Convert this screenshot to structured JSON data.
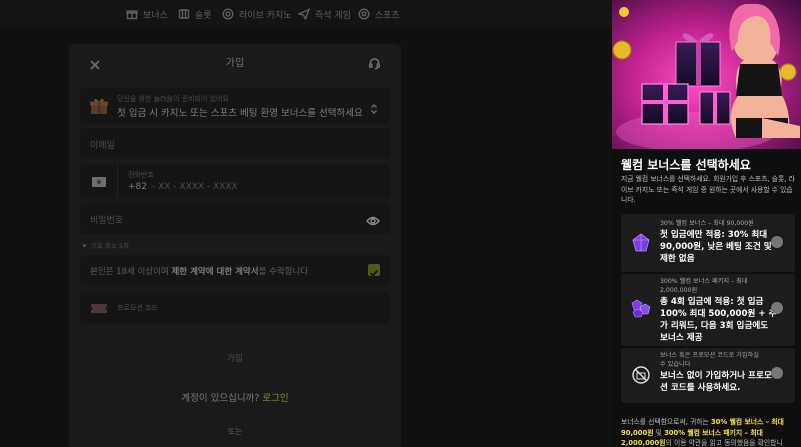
{
  "nav": {
    "items": [
      {
        "label": "보너스",
        "icon": "gift-icon"
      },
      {
        "label": "슬롯",
        "icon": "slot-machine-icon"
      },
      {
        "label": "라이브 카지노",
        "icon": "casino-chip-icon"
      },
      {
        "label": "즉석 게임",
        "icon": "paper-plane-icon"
      },
      {
        "label": "스포츠",
        "icon": "soccer-ball-icon"
      }
    ]
  },
  "signup": {
    "title": "가입",
    "bonus_hint": "당신을 위한 놀라움이 준비되어 있어요",
    "bonus_value": "첫 입금 시 카지노 또는 스포츠 베팅 환영 보너스를 선택하세요",
    "email_placeholder": "이메일",
    "phone_label": "전화번호",
    "phone_code": "+82",
    "phone_mask": "- XX - XXXX - XXXX",
    "password_placeholder": "비밀번호",
    "password_rule": "기호 최소 5자",
    "terms_prefix": "본인은 18세 이상이며 ",
    "terms_link": "제한 계약에 대한 계약서",
    "terms_suffix": "를 수락합니다",
    "promo_placeholder": "프로모션 코드",
    "submit_label": "가입",
    "login_question": "계정이 있으십니까?",
    "login_link": "로그인",
    "or_label": "또는"
  },
  "bonus_panel": {
    "title": "웰컴 보너스를 선택하세요",
    "description": "지금 웰컴 보너스를 선택하세요. 회원가입 후 스포츠, 슬롯, 라이브 카지노 또는 즉석 게임 중 원하는 곳에서 사용할 수 있습니다.",
    "options": [
      {
        "tag": "30% 웰컴 보너스 – 최대 90,000원",
        "text": "첫 입금에만 적용: 30% 최대 90,000원, 낮은 베팅 조건 및 제한 없음",
        "icon": "purple-gem-icon",
        "selected": false
      },
      {
        "tag": "300% 웰컴 보너스 패키지 – 최대 2,000,000원",
        "text": "총 4회 입금에 적용: 첫 입금 100% 최대 500,000원 + 추가 리워드, 다음 3회 입금에도 보너스 제공",
        "icon": "purple-gems-icon",
        "selected": false
      },
      {
        "tag": "보너스 혹은 프로모션 코드로 가입하실 수 있습니다",
        "text": "보너스 없이 가입하거나 프로모션 코드를 사용하세요.",
        "icon": "no-bonus-icon",
        "selected": false
      }
    ],
    "footer_prefix": "보너스를 선택함으로써, 귀하는 ",
    "footer_hl1": "30% 웰컴 보너스 – 최대 90,000원",
    "footer_mid": " 및 ",
    "footer_hl2": "300% 웰컴 보너스 패키지 – 최대 2,000,000원",
    "footer_suffix": "의 이용 약관을 읽고 동의했음을 확인합니"
  },
  "colors": {
    "accent": "#8a8f3a",
    "highlight": "#f3e04b",
    "hero_pink": "#d82c9a"
  }
}
